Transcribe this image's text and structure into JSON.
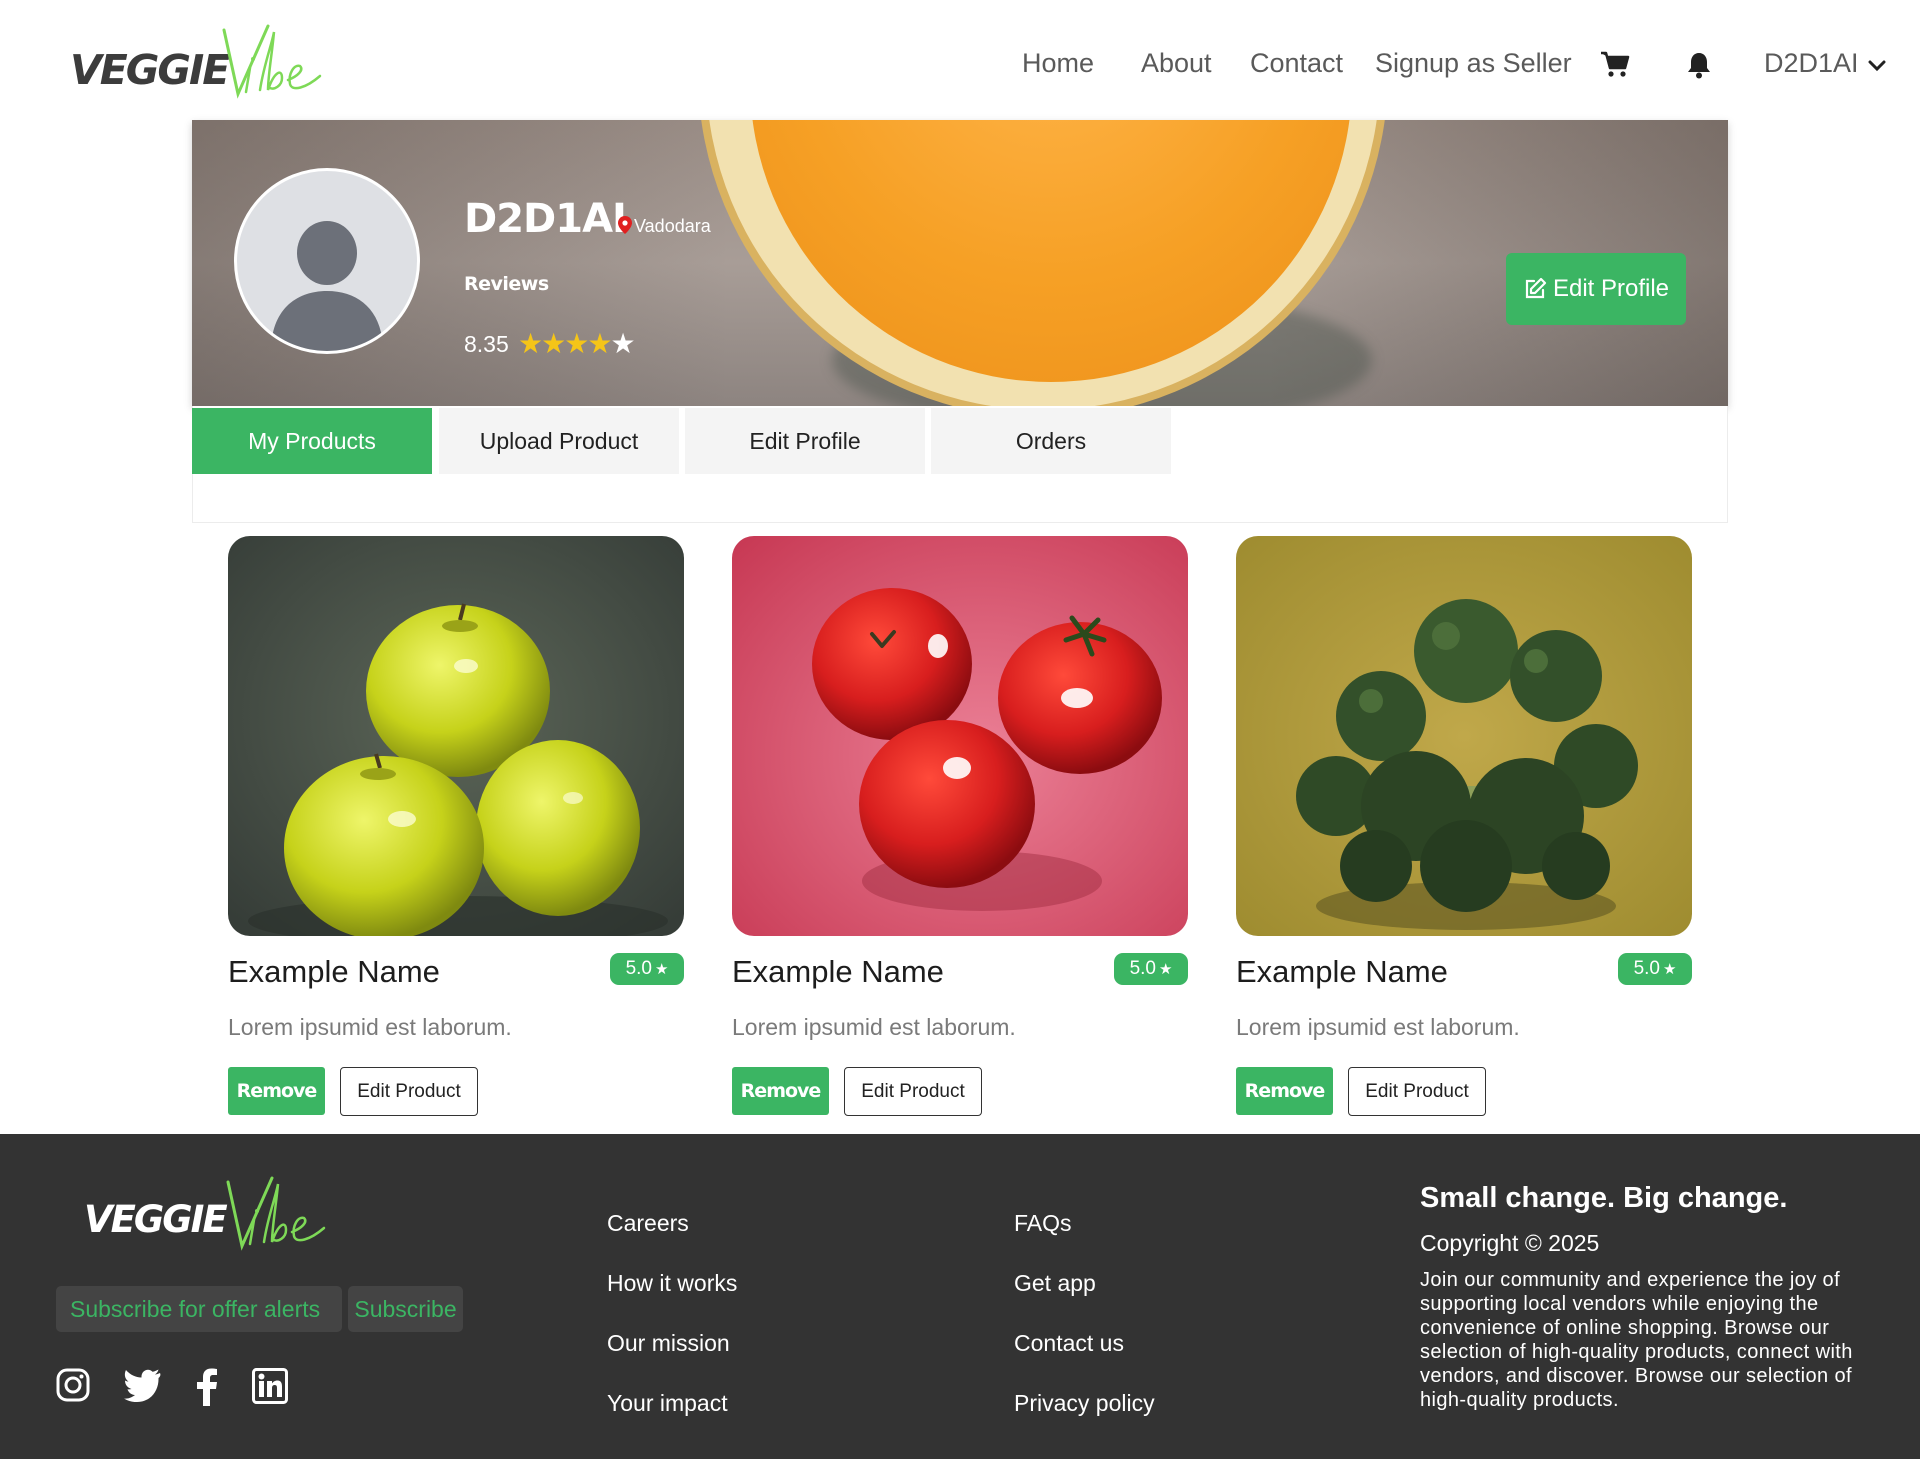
{
  "brand": {
    "name_bold": "VEGGIE",
    "name_script": "Vibe",
    "accent_color": "#3bb563",
    "footer_bg": "#333333"
  },
  "nav": {
    "items": [
      {
        "label": "Home"
      },
      {
        "label": "About"
      },
      {
        "label": "Contact"
      },
      {
        "label": "Signup as Seller"
      }
    ],
    "cart_icon": "cart-icon",
    "bell_icon": "bell-icon",
    "user_label": "D2D1AI"
  },
  "profile": {
    "name": "D2D1AI",
    "location": "Vadodara",
    "reviews_label": "Reviews",
    "rating": "8.35",
    "stars_filled": 4,
    "stars_total": 5,
    "edit_button": "Edit Profile"
  },
  "tabs": [
    {
      "label": "My Products",
      "active": true
    },
    {
      "label": "Upload Product",
      "active": false
    },
    {
      "label": "Edit Profile",
      "active": false
    },
    {
      "label": "Orders",
      "active": false
    }
  ],
  "products": [
    {
      "name": "Example Name",
      "rating": "5.0",
      "description": "Lorem ipsumid est laborum.",
      "remove_label": "Remove",
      "edit_label": "Edit Product",
      "image": "green-apples"
    },
    {
      "name": "Example Name",
      "rating": "5.0",
      "description": "Lorem ipsumid est laborum.",
      "remove_label": "Remove",
      "edit_label": "Edit Product",
      "image": "red-tomatoes"
    },
    {
      "name": "Example Name",
      "rating": "5.0",
      "description": "Lorem ipsumid est laborum.",
      "remove_label": "Remove",
      "edit_label": "Edit Product",
      "image": "broccoli"
    }
  ],
  "footer": {
    "subscribe_placeholder": "Subscribe for offer alerts",
    "subscribe_button": "Subscribe",
    "social": [
      "instagram-icon",
      "twitter-icon",
      "facebook-icon",
      "linkedin-icon"
    ],
    "col1": [
      "Careers",
      "How it works",
      "Our mission",
      "Your impact"
    ],
    "col2": [
      "FAQs",
      "Get app",
      "Contact us",
      "Privacy policy"
    ],
    "tagline": "Small change. Big change.",
    "copyright": "Copyright © 2025",
    "about": "Join our community and experience the joy of supporting local vendors while enjoying the convenience of online shopping. Browse our selection of high-quality products, connect with vendors, and discover. Browse our selection of high-quality products."
  }
}
